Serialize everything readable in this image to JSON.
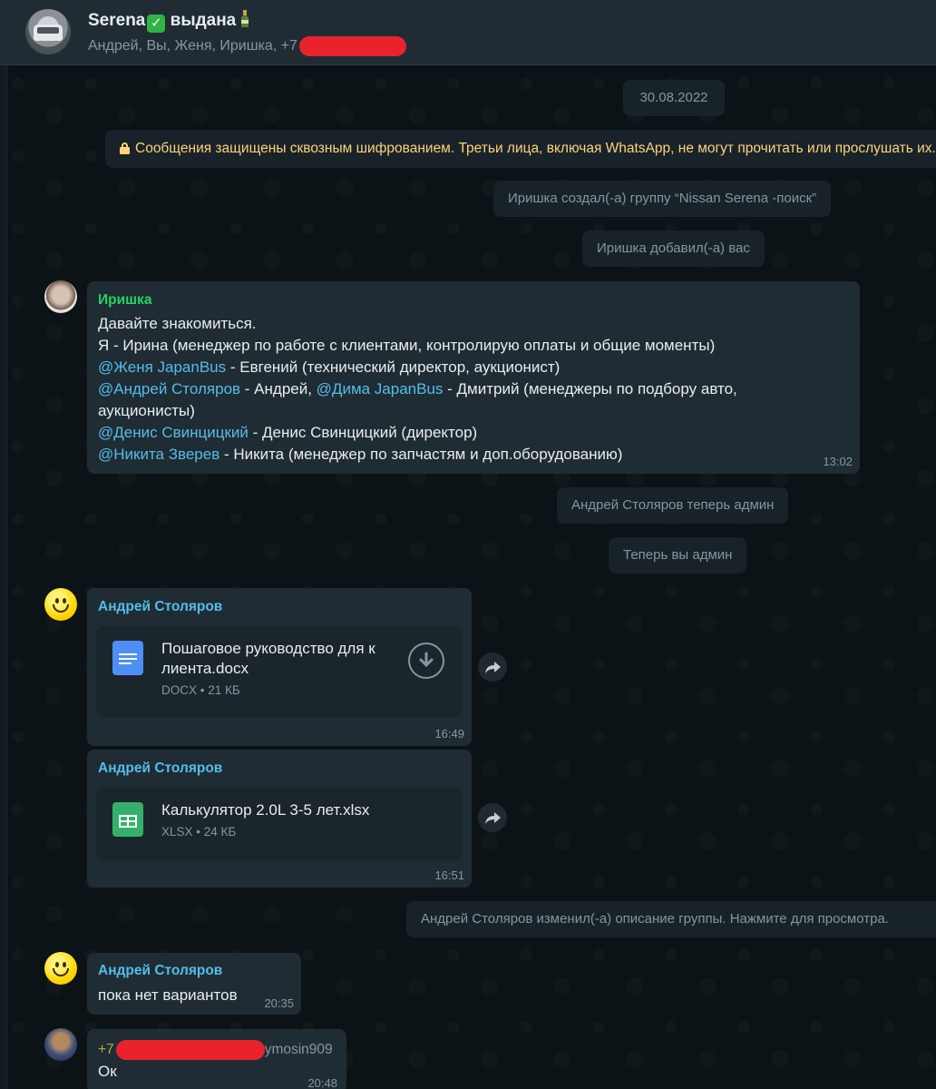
{
  "header": {
    "title": "Serena",
    "title_suffix": "выдана",
    "members": "Андрей, Вы, Женя, Иришка, +7"
  },
  "system": {
    "date": "30.08.2022",
    "encryption": "Сообщения защищены сквозным шифрованием. Третьи лица, включая WhatsApp, не могут прочитать или прослушать их.",
    "created": "Иришка создал(-а) группу “Nissan Serena -поиск”",
    "added": "Иришка добавил(-а) вас",
    "admin1": "Андрей Столяров теперь админ",
    "admin2": "Теперь вы админ",
    "desc_changed": "Андрей Столяров изменил(-а) описание группы. Нажмите для просмотра."
  },
  "messages": {
    "m1": {
      "sender": "Иришка",
      "line1": "Давайте знакомиться.",
      "line2": "Я - Ирина (менеджер по работе с клиентами, контролирую оплаты и общие моменты)",
      "mention_zhenya": "@Женя JapanBus",
      "line3_rest": " - Евгений (технический директор, аукционист)",
      "mention_andrey": "@Андрей Столяров",
      "line4_mid": " - Андрей, ",
      "mention_dima": "@Дима JapanBus",
      "line4_rest": " - Дмитрий (менеджеры по подбору авто,",
      "line5": "аукционисты)",
      "mention_denis": "@Денис Свинцицкий",
      "line6_rest": " - Денис Свинцицкий (директор)",
      "mention_nikita": "@Никита Зверев",
      "line7_rest": " - Никита (менеджер по запчастям и доп.оборудованию)",
      "time": "13:02"
    },
    "m2": {
      "sender": "Андрей Столяров",
      "file_line1": "Пошаговое руководство для к",
      "file_line2": "лиента.docx",
      "file_meta": "DOCX • 21 КБ",
      "time": "16:49"
    },
    "m3": {
      "sender": "Андрей Столяров",
      "file_name": "Калькулятор 2.0L 3-5 лет.xlsx",
      "file_meta": "XLSX • 24 КБ",
      "time": "16:51"
    },
    "m4": {
      "sender": "Андрей Столяров",
      "text": "пока нет вариантов",
      "time": "20:35"
    },
    "m5": {
      "sender_prefix": "+7",
      "sender_suffix": "ymosin909",
      "text": "Ок",
      "time": "20:48"
    }
  },
  "colors": {
    "mention": "#53bdeb",
    "sender_irishka": "#25d366",
    "sender_andrey": "#53bdeb",
    "sender_phone": "#a5b337",
    "encryption_text": "#ffd279"
  }
}
